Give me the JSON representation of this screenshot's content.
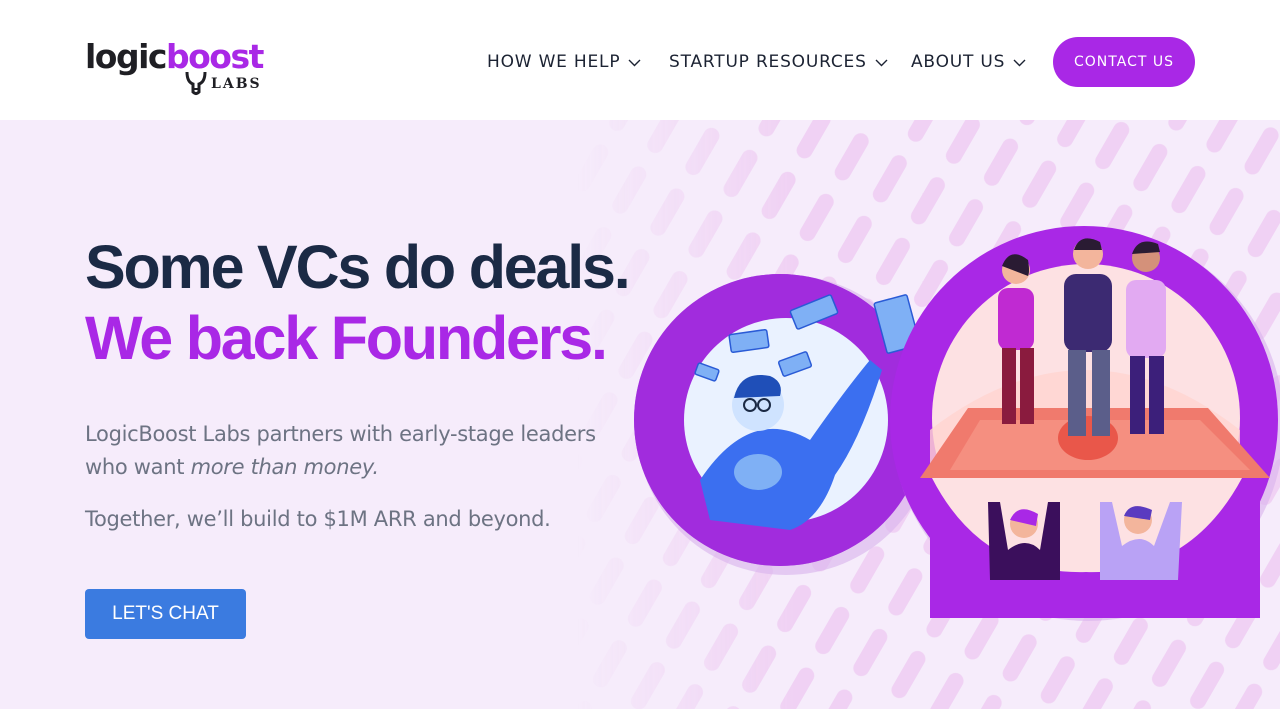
{
  "header": {
    "logo": {
      "word_part_1": "logic",
      "word_part_2": "boost",
      "sub": "LABS"
    },
    "nav": [
      {
        "label": "HOW WE HELP",
        "icon": "chevron-down-icon"
      },
      {
        "label": "STARTUP RESOURCES",
        "icon": "chevron-down-icon"
      },
      {
        "label": "ABOUT US",
        "icon": "chevron-down-icon"
      }
    ],
    "contact_label": "CONTACT US"
  },
  "hero": {
    "headline_1": "Some VCs do deals.",
    "headline_2": "We back Founders.",
    "para_1_before": "LogicBoost Labs partners with early-stage leaders who want ",
    "para_1_em": "more than money.",
    "para_2": "Together, we’ll build to $1M ARR and beyond.",
    "cta_label": "LET'S CHAT"
  },
  "colors": {
    "brand_purple": "#a928e6",
    "navy": "#1b2a45",
    "cta_blue": "#3b7be0",
    "hero_bg": "#f6ecfb",
    "body_text": "#6d7383"
  }
}
